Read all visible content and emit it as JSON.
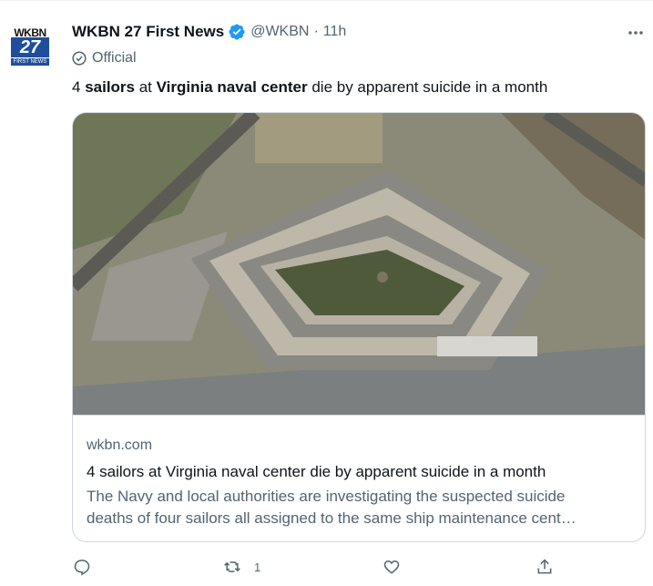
{
  "avatar": {
    "brand": "WKBN",
    "number": "27",
    "subtitle": "FIRST NEWS"
  },
  "tweet": {
    "author": "WKBN 27 First News",
    "handle": "@WKBN",
    "separator": "·",
    "timestamp": "11h",
    "label": "Official",
    "text_parts": {
      "p1": "4 ",
      "b1": "sailors",
      "p2": " at ",
      "b2": "Virginia naval center",
      "p3": " die by apparent suicide in a month"
    }
  },
  "card": {
    "domain": "wkbn.com",
    "title": "4 sailors at Virginia naval center die by apparent suicide in a month",
    "description_line1": "The Navy and local authorities are investigating the suspected suicide",
    "description_line2": "deaths of four sailors all assigned to the same ship maintenance cent…"
  },
  "actions": {
    "reply_count": "",
    "retweet_count": "1",
    "like_count": ""
  },
  "colors": {
    "verified": "#1d9bf0",
    "secondary_text": "#536471",
    "border": "#cfd9de"
  },
  "icons": [
    "verified-badge-icon",
    "more-icon",
    "official-icon",
    "reply-icon",
    "retweet-icon",
    "like-icon",
    "share-icon"
  ]
}
